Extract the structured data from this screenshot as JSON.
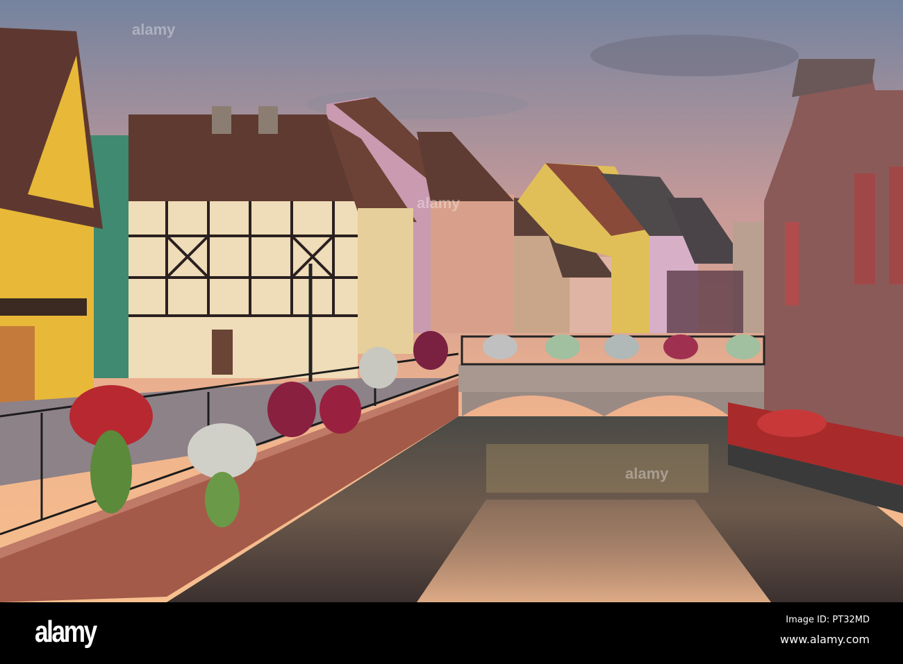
{
  "photo": {
    "subject": "canal-with-half-timbered-houses"
  },
  "footer": {
    "logo": "alamy",
    "image_id": "Image ID: PT32MD",
    "url": "www.alamy.com"
  },
  "watermark": "alamy",
  "colors": {
    "sky_top": "#74839f",
    "sky_bottom": "#f2b183",
    "water": "#5a4e48"
  }
}
